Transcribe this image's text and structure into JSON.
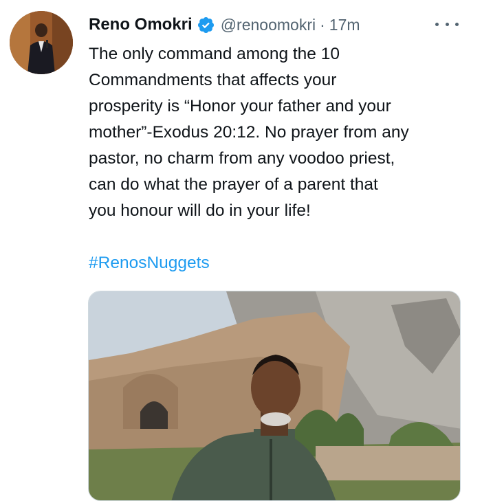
{
  "author": {
    "name": "Reno Omokri",
    "handle": "@renoomokri",
    "separator": "·",
    "time": "17m",
    "verified": true
  },
  "tweet": {
    "lines": [
      "The only command among the 10",
      "Commandments that affects your",
      "prosperity is “Honor your father and your",
      "mother”-Exodus 20:12. No prayer from any",
      "pastor, no charm from any voodoo priest,",
      "can do what the prayer of a parent that",
      "you honour will do in your life!"
    ],
    "hashtag": "#RenosNuggets"
  },
  "icons": {
    "verified": "verified-badge-icon",
    "more": "more-options-icon"
  },
  "colors": {
    "link": "#1d9bf0",
    "secondary_text": "#536471",
    "primary_text": "#0f1419",
    "verified": "#1d9bf0"
  }
}
